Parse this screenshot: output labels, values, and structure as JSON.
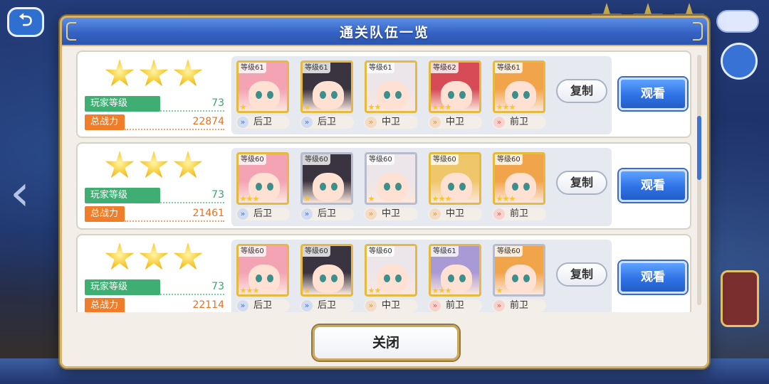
{
  "modal": {
    "title": "通关队伍一览",
    "close_label": "关闭"
  },
  "labels": {
    "player_level": "玩家等级",
    "total_power": "总战力",
    "copy": "复制",
    "watch": "观看"
  },
  "teams": [
    {
      "stars": 3,
      "player_level": "73",
      "total_power": "22874",
      "units": [
        {
          "level": "等级61",
          "position": "后卫",
          "rank_stars": 1,
          "hair": "#f4a3b4",
          "frame": "gold"
        },
        {
          "level": "等级61",
          "position": "后卫",
          "rank_stars": 1,
          "hair": "#3a3440",
          "frame": "gold"
        },
        {
          "level": "等级61",
          "position": "中卫",
          "rank_stars": 2,
          "hair": "#ece6ea",
          "frame": "gold"
        },
        {
          "level": "等级62",
          "position": "中卫",
          "rank_stars": 3,
          "hair": "#d64b55",
          "frame": "gold"
        },
        {
          "level": "等级61",
          "position": "前卫",
          "rank_stars": 3,
          "hair": "#f2a44a",
          "frame": "gold"
        }
      ]
    },
    {
      "stars": 3,
      "player_level": "73",
      "total_power": "21461",
      "units": [
        {
          "level": "等级60",
          "position": "后卫",
          "rank_stars": 3,
          "hair": "#f4a3b4",
          "frame": "gold"
        },
        {
          "level": "等级60",
          "position": "后卫",
          "rank_stars": 1,
          "hair": "#3a3440",
          "frame": "silver"
        },
        {
          "level": "等级60",
          "position": "中卫",
          "rank_stars": 1,
          "hair": "#ece6ea",
          "frame": "silver"
        },
        {
          "level": "等级60",
          "position": "中卫",
          "rank_stars": 3,
          "hair": "#f0c66a",
          "frame": "gold"
        },
        {
          "level": "等级60",
          "position": "前卫",
          "rank_stars": 3,
          "hair": "#f2a44a",
          "frame": "gold"
        }
      ]
    },
    {
      "stars": 3,
      "player_level": "73",
      "total_power": "22114",
      "units": [
        {
          "level": "等级60",
          "position": "后卫",
          "rank_stars": 3,
          "hair": "#f4a3b4",
          "frame": "gold"
        },
        {
          "level": "等级60",
          "position": "后卫",
          "rank_stars": 1,
          "hair": "#3a3440",
          "frame": "gold"
        },
        {
          "level": "等级60",
          "position": "中卫",
          "rank_stars": 2,
          "hair": "#ece6ea",
          "frame": "gold"
        },
        {
          "level": "等级61",
          "position": "前卫",
          "rank_stars": 3,
          "hair": "#a99ad6",
          "frame": "gold"
        },
        {
          "level": "等级60",
          "position": "前卫",
          "rank_stars": 1,
          "hair": "#f2a44a",
          "frame": "silver"
        }
      ]
    }
  ],
  "colors": {
    "header_blue": "#3563c4",
    "accent_gold": "#d5b36a",
    "level_green": "#3fae73",
    "power_orange": "#ef7d2a"
  },
  "icons": {
    "back": "back-arrow-icon",
    "star": "star-icon",
    "position_chevron": "double-chevron-icon"
  }
}
